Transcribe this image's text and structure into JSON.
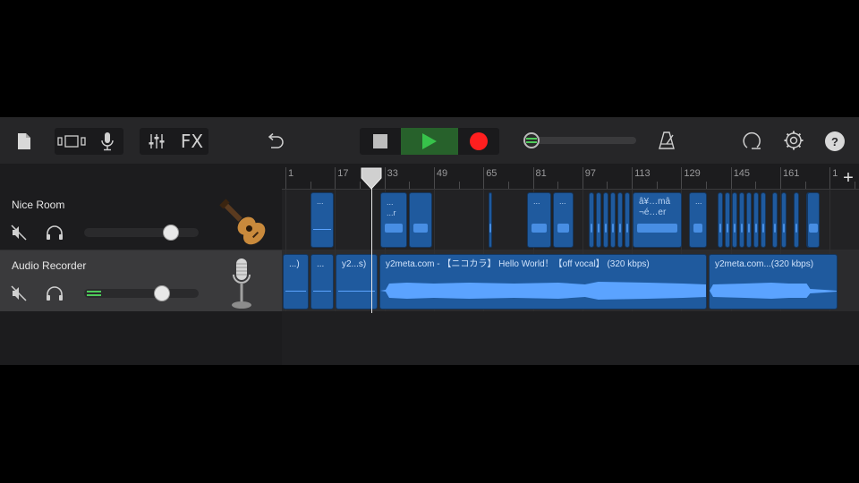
{
  "toolbar": {
    "buttons": [
      {
        "name": "my-songs-icon"
      },
      {
        "name": "track-view-icon"
      },
      {
        "name": "microphone-icon"
      },
      {
        "name": "mixer-icon"
      },
      {
        "name": "fx",
        "label": "FX"
      },
      {
        "name": "undo-icon"
      },
      {
        "name": "stop-icon"
      },
      {
        "name": "play-icon"
      },
      {
        "name": "record-icon"
      },
      {
        "name": "metronome-icon"
      },
      {
        "name": "loop-browser-icon"
      },
      {
        "name": "settings-icon"
      },
      {
        "name": "help-icon",
        "label": "?"
      }
    ],
    "colors": {
      "play_bg": "#27612b",
      "play_icon": "#37c24a",
      "record": "#ff1f1f"
    }
  },
  "ruler": {
    "markers": [
      "1",
      "17",
      "33",
      "49",
      "65",
      "81",
      "97",
      "113",
      "129",
      "145",
      "161",
      "1"
    ],
    "add_label": "+"
  },
  "tracks": [
    {
      "name": "Nice Room",
      "instrument_icon": "acoustic-guitar-icon",
      "volume": 0.8
    },
    {
      "name": "Audio Recorder",
      "instrument_icon": "microphone-stand-icon",
      "volume": 0.73
    }
  ],
  "regions": {
    "track1": [
      {
        "label": "..."
      },
      {
        "label": "..."
      },
      {
        "label": "...r"
      },
      {
        "label": "..."
      },
      {
        "label": "..."
      },
      {
        "label": "..."
      },
      {
        "label": "â¥…mâ"
      },
      {
        "label": "¬é…er"
      },
      {
        "label": "..."
      }
    ],
    "track2": [
      {
        "label": "...)"
      },
      {
        "label": "..."
      },
      {
        "label": "y2...s)"
      },
      {
        "label": "y2meta.com - 【ニコカラ】 Hello World！【off vocal】 (320 kbps)"
      },
      {
        "label": "y2meta.com...(320 kbps)"
      }
    ]
  },
  "colors": {
    "region": "#1f5a9e",
    "waveform": "#5ba3ff",
    "level_meter": "#4ecb5a"
  }
}
